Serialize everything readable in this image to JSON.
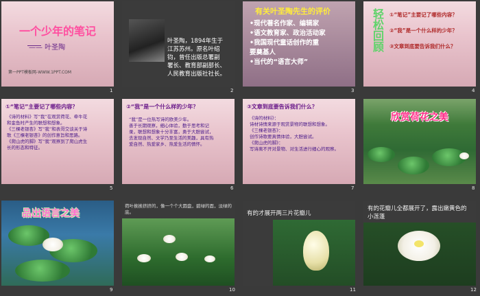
{
  "slides": [
    {
      "num": "1",
      "title": "一个少年的笔记",
      "author": "—— 叶圣陶",
      "footer": "第一PPT模板网-WWW.1PPT.COM"
    },
    {
      "num": "2",
      "bio": [
        "叶圣陶，1894年生于",
        "江苏苏州。原名叶绍",
        "钧，曾任出版总署副",
        "署长、教育部副部长、",
        "人民教育出版社社长。"
      ]
    },
    {
      "num": "3",
      "heading": "有关叶圣陶先生的评价",
      "bullets": [
        "•现代著名作家、编辑家",
        "•语文教育家、政治活动家",
        "•我国现代童话创作的重",
        "  要奠基人",
        "•当代的“语言大师”"
      ]
    },
    {
      "num": "4",
      "vertical": "轻松回顾",
      "questions": [
        "①“笔记”主要记了哪些内容？",
        "②“我”是一个什么样的少年？",
        "③文章到底要告诉我们什么？"
      ]
    },
    {
      "num": "5",
      "heading": "①“笔记”主要记了哪些内容？",
      "lines": [
        "《诗的材料》写“我”在观赏荷花、牵牛花",
        "和金鱼时产生的联想和想象。",
        "《三棵老银杏》写“我”和表哥交谈关于诗",
        "歌《三棵老银杏》的创作意旨和思路。",
        "《爬山虎的脚》写“我”观察到了爬山虎生",
        "长的形态和特征。"
      ]
    },
    {
      "num": "6",
      "heading": "②“我”是一个什么样的少年？",
      "lines": [
        "“我”是一位热写诗的欧美少年。",
        "善于长期观察，细心体验，勤于思考和记",
        "录，联想和想象十分丰富，勇于大胆尝试，",
        "去发现自然、文学乃至生活的美趣，具有热",
        "爱自然、热爱家乡、热爱生活的情怀。"
      ]
    },
    {
      "num": "7",
      "heading": "③文章到底要告诉我们什么？",
      "lines": [
        "《诗的材料》：",
        "诗材诗情来源于观赏景物的联想和想象。",
        "《三棵老银杏》：",
        "创作诗歌要真情体验，大胆尝试。",
        "《爬山虎的脚》：",
        "写诗离不开对景物、对生活进行细心的观察。"
      ]
    },
    {
      "num": "8",
      "banner": "欣赏荷花之美"
    },
    {
      "num": "9",
      "banner": "品出语言之美"
    },
    {
      "num": "10",
      "caption": "荷叶挨挨挤挤的，像一个个大圆盘，碧绿的面，淡绿的底。"
    },
    {
      "num": "11",
      "caption": "有的才展开两三片花瓣儿"
    },
    {
      "num": "12",
      "caption": "有的花瓣儿全都展开了，露出嫩黄色的小莲蓬"
    }
  ],
  "colors": {
    "pink_title": "#ff4fa0",
    "yellow_heading": "#ffec3a",
    "purple_text": "#5a1a7a"
  }
}
